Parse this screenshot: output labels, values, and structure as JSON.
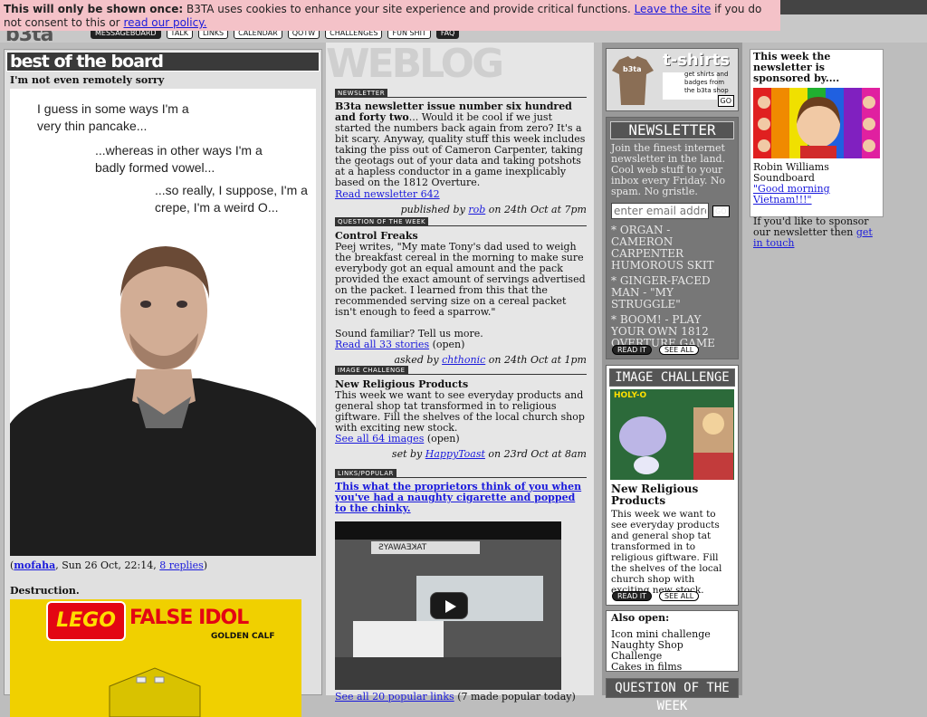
{
  "cookie": {
    "lead": "This will only be shown once:",
    "text": " B3TA uses cookies to enhance your site experience and provide critical functions. ",
    "leave_link": "Leave the site",
    "mid": " if you do not consent to this or ",
    "policy_link": "read our policy."
  },
  "logo": "b3ta",
  "nav": [
    "MESSAGEBOARD",
    "TALK",
    "LINKS",
    "CALENDAR",
    "QOTW",
    "CHALLENGES",
    "FUN SHIT",
    "FAQ"
  ],
  "botb": {
    "heading": "best of the board",
    "post1": {
      "title": "I'm not even remotely sorry",
      "comic_lines": [
        "I guess in some ways I'm a",
        "very thin pancake...",
        "...whereas in other ways I'm a",
        "badly formed vowel...",
        "...so really, I suppose, I'm a",
        "crepe, I'm a weird O..."
      ],
      "author": "mofaha",
      "date": ", Sun 26 Oct, 22:14, ",
      "replies": "8 replies"
    },
    "post2": {
      "title": "Destruction.",
      "img_text1": "LEGO",
      "img_text2": "FALSE IDOL",
      "img_text3": "GOLDEN CALF"
    }
  },
  "weblog": {
    "title": "WEBLOG",
    "newsletter": {
      "label": "NEWSLETTER",
      "title": "B3ta newsletter issue number six hundred and forty two",
      "body": "... Would it be cool if we just started the numbers back again from zero? It's a bit scary. Anyway, quality stuff this week includes taking the piss out of Cameron Carpenter, taking the geotags out of your data and taking potshots at a hapless conductor in a game inexplicably based on the 1812 Overture.",
      "link": "Read newsletter 642",
      "by_prefix": "published by ",
      "by_author": "rob",
      "by_suffix": " on 24th Oct at 7pm"
    },
    "qotw": {
      "label": "QUESTION OF THE WEEK",
      "title": "Control Freaks",
      "body": "Peej writes, \"My mate Tony's dad used to weigh the breakfast cereal in the morning to make sure everybody got an equal amount and the pack provided the exact amount of servings advertised on the packet. I learned from this that the recommended serving size on a cereal packet isn't enough to feed a sparrow.\"",
      "body2": "Sound familiar? Tell us more.",
      "link": "Read all 33 stories",
      "status": " (open)",
      "by_prefix": "asked by ",
      "by_author": "chthonic",
      "by_suffix": " on 24th Oct at 1pm"
    },
    "imgchal": {
      "label": "IMAGE CHALLENGE",
      "title": "New Religious Products",
      "body": "This week we want to see everyday products and general shop tat transformed in to religious giftware. Fill the shelves of the local church shop with exciting new stock.",
      "link": "See all 64 images",
      "status": " (open)",
      "by_prefix": "set by ",
      "by_author": "HappyToast",
      "by_suffix": " on 23rd Oct at 8am"
    },
    "links": {
      "label": "LINKS/POPULAR",
      "headline": "This what the proprietors think of you when you've had a naughty cigarette and popped to the chinky.",
      "video_sign": "TAKEAWAYS",
      "footer_link": "See all 20 popular links",
      "footer_text": " (7 made popular today)"
    }
  },
  "rcol": {
    "tshirts": {
      "title": "t-shirts",
      "body": "get shirts and badges from the b3ta shop",
      "go": "GO",
      "shirt_text": "b3ta"
    },
    "newsletter": {
      "heading": "NEWSLETTER",
      "text": "Join the finest internet newsletter in the land. Cool web stuff to your inbox every Friday. No spam. No gristle.",
      "email_placeholder": "enter email addre",
      "go": "GO",
      "items": [
        "* ORGAN - CAMERON CARPENTER HUMOROUS SKIT",
        "* GINGER-FACED MAN - \"MY STRUGGLE\"",
        "* BOOM! - PLAY YOUR OWN 1812 OVERTURE GAME"
      ],
      "read_it": "READ IT",
      "see_all": "SEE ALL"
    },
    "imgchal": {
      "heading": "IMAGE CHALLENGE",
      "title": "New Religious Products",
      "body": "This week we want to see everyday products and general shop tat transformed in to religious giftware. Fill the shelves of the local church shop with exciting new stock.",
      "read_it": "READ IT",
      "see_all": "SEE ALL",
      "pic_text": "HOLY-O"
    },
    "also_open": {
      "heading": "Also open:",
      "items": [
        "Icon mini challenge",
        "Naughty Shop Challenge",
        "Cakes in films"
      ]
    },
    "qotw_heading": "QUESTION OF THE WEEK"
  },
  "sponsor": {
    "title": "This week the newsletter is sponsored by....",
    "name": "Robin Williams Soundboard",
    "link": "\"Good morning Vietnam!!!\"",
    "footer": "If you'd like to sponsor our newsletter then ",
    "footer_link": "get in touch"
  },
  "colors": {
    "cookie_bg": "#f4c2c8",
    "link": "#1a1adc",
    "header_dark": "#3a3a3a"
  }
}
